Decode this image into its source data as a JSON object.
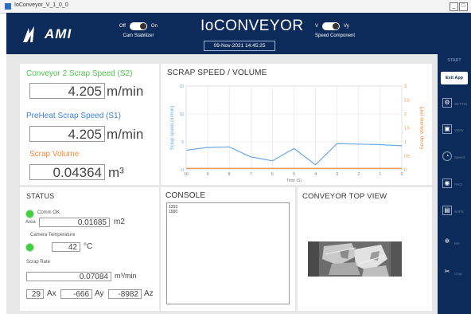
{
  "window": {
    "title": "IoConveyor_V_1_0_0",
    "minimize": "_",
    "maximize": "□"
  },
  "header": {
    "logo_text": "AMI",
    "app_title": "IoCONVEYOR",
    "datetime": "09-Nov-2021 14:45:25",
    "toggle1": {
      "off_label": "Off",
      "on_label": "On",
      "caption": "Cam Stabilizer"
    },
    "toggle2": {
      "left_label": "V",
      "right_label": "Vy",
      "caption": "Speed Component"
    },
    "bg_color": "#0c2a5a"
  },
  "speeds": {
    "s2_label": "Conveyor 2 Scrap Speed (S2)",
    "s2_value": "4.205",
    "s2_unit": "m/min",
    "s1_label": "PreHeat Scrap Speed (S1)",
    "s1_value": "4.205",
    "s1_unit": "m/min",
    "vol_label": "Scrap Volume",
    "vol_value": "0.04364",
    "vol_unit": "m³"
  },
  "chart_panel": {
    "title": "SCRAP SPEED / VOLUME"
  },
  "chart_data": {
    "type": "line",
    "xlabel": "Time (S)",
    "ylabel_left": "Scrap speed (m/min)",
    "ylabel_right": "Scrap Volume (m³)",
    "xlim": [
      10,
      0
    ],
    "ylim_left": [
      0,
      15
    ],
    "ylim_right": [
      0,
      3
    ],
    "x_ticks": [
      "10",
      "9",
      "8",
      "7",
      "6",
      "5",
      "4",
      "3",
      "2",
      "1",
      "0"
    ],
    "y_left_ticks": [
      "0",
      "5",
      "10",
      "15"
    ],
    "y_right_ticks": [
      "0",
      "0.5",
      "1",
      "1.5",
      "2",
      "2.5",
      "3"
    ],
    "series": [
      {
        "axis": "left",
        "color": "#6aa9e6",
        "x": [
          10,
          9,
          8,
          7,
          6,
          5,
          4,
          3,
          2,
          1,
          0
        ],
        "y": [
          3.5,
          4.0,
          4.1,
          2.3,
          1.6,
          3.8,
          0.9,
          4.7,
          4.6,
          4.5,
          4.3
        ]
      },
      {
        "axis": "right",
        "color": "#ef8a3c",
        "x": [
          10,
          0
        ],
        "y": [
          0.05,
          0.05
        ]
      }
    ],
    "grid": true
  },
  "status": {
    "title": "STATUS",
    "comm_label": "Comm OK",
    "area_label": "Area",
    "area_value": "0.01685",
    "area_unit": "m2",
    "cam_temp_label": "Camera Temperature",
    "cam_temp_value": "42",
    "cam_temp_unit": "°C",
    "scrap_rate_label": "Scrap Rate",
    "scrap_rate_value": "0.07084",
    "scrap_rate_unit": "m³/min",
    "ax_value": "29",
    "ax_label": "Ax",
    "ay_value": "-666",
    "ay_label": "Ay",
    "az_value": "-8982",
    "az_label": "Az"
  },
  "console": {
    "title": "CONSOLE",
    "line1": "1203",
    "line2": "1000"
  },
  "conveyor": {
    "title": "CONVEYOR TOP VIEW"
  },
  "sidebar": {
    "start": "START",
    "exit": "Exit App",
    "items": [
      "SETTIN",
      "VIEW",
      "Speed",
      "PHO",
      "SAFE",
      "MA",
      "Crop"
    ]
  }
}
